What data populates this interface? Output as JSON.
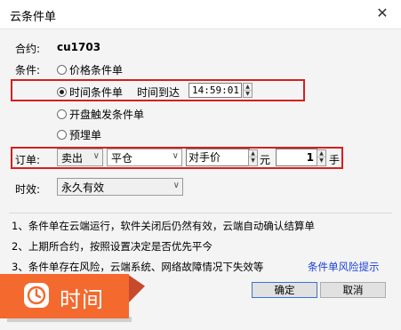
{
  "window": {
    "title": "云条件单",
    "close_glyph": "✕"
  },
  "contract": {
    "label": "合约:",
    "value": "cu1703"
  },
  "condition": {
    "label": "条件:",
    "options": [
      "价格条件单",
      "时间条件单",
      "开盘触发条件单",
      "预埋单"
    ],
    "selected": "时间条件单",
    "time_label": "时间到达",
    "time_value": "14:59:01"
  },
  "order": {
    "label": "订单:",
    "direction": "卖出",
    "offset": "平仓",
    "price_type": "对手价",
    "price_unit": "元",
    "quantity": "1",
    "quantity_unit": "手"
  },
  "validity": {
    "label": "时效:",
    "value": "永久有效"
  },
  "notes": [
    "1、条件单在云端运行，软件关闭后仍然有效，云端自动确认结算单",
    "2、上期所合约，按照设置决定是否优先平今",
    "3、条件单存在风险，云端系统、网络故障情况下失效等"
  ],
  "risk_link": "条件单风险提示",
  "buttons": {
    "ok": "确定",
    "cancel": "取消"
  },
  "badge": {
    "text": "时间",
    "icon": "clock-icon"
  },
  "colors": {
    "highlight_border": "#d4201e",
    "badge_bg": "#f4692d",
    "link": "#1a3fd6"
  }
}
